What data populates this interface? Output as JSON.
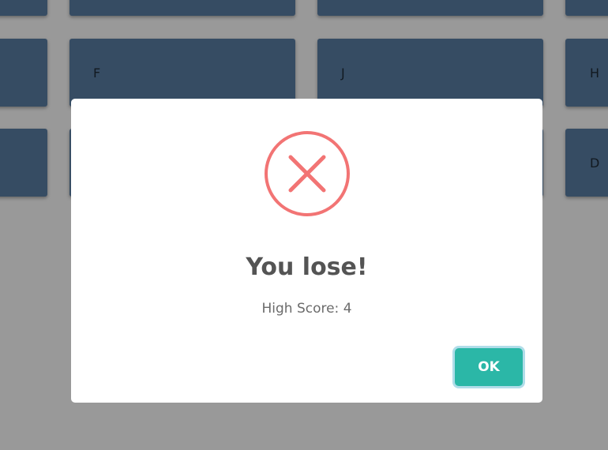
{
  "board": {
    "tiles": [
      {
        "label": ""
      },
      {
        "label": ""
      },
      {
        "label": ""
      },
      {
        "label": ""
      },
      {
        "label": ""
      },
      {
        "label": "F"
      },
      {
        "label": "J"
      },
      {
        "label": "H"
      },
      {
        "label": ""
      },
      {
        "label": ""
      },
      {
        "label": ""
      },
      {
        "label": "D"
      }
    ],
    "tile_color": "#5b7fa6"
  },
  "dialog": {
    "icon": "error-x-circle-icon",
    "icon_color": "#f27474",
    "title": "You lose!",
    "text": "High Score: 4",
    "confirm_label": "OK",
    "confirm_color": "#2bb7a7"
  }
}
